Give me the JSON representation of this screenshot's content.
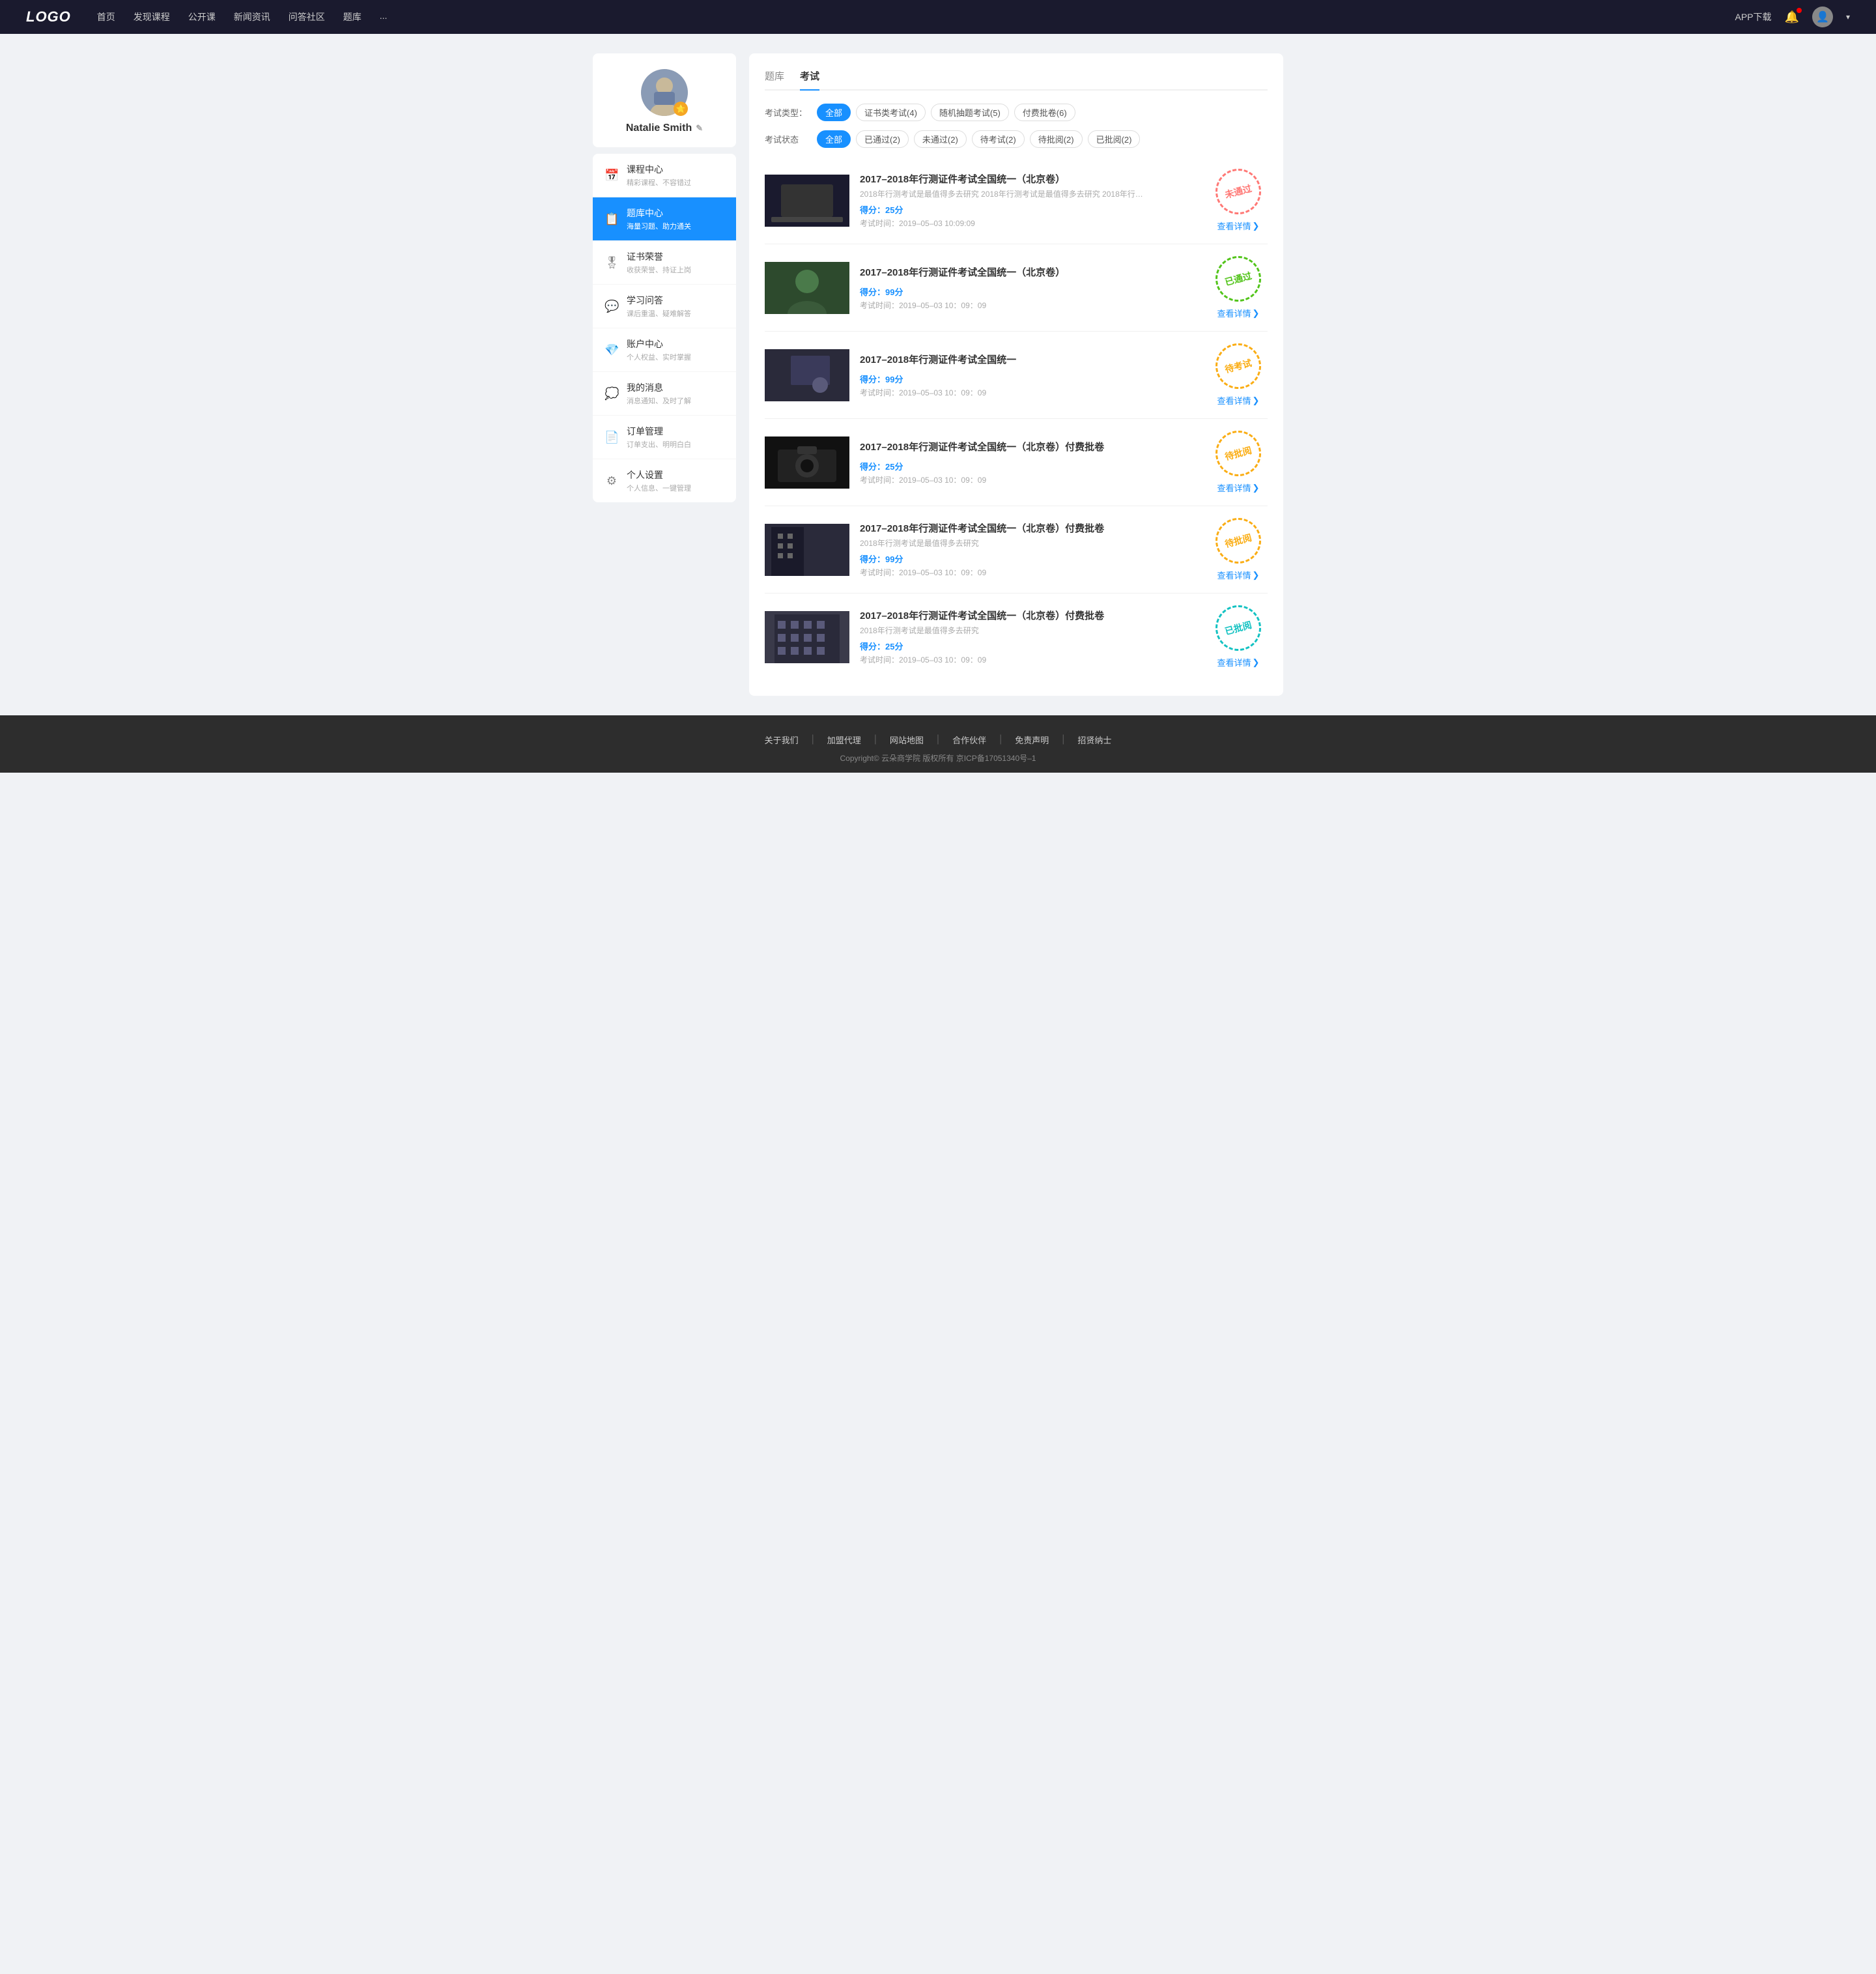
{
  "navbar": {
    "logo": "LOGO",
    "links": [
      "首页",
      "发现课程",
      "公开课",
      "新闻资讯",
      "问答社区",
      "题库",
      "..."
    ],
    "app_download": "APP下载",
    "dropdown_icon": "▾"
  },
  "sidebar": {
    "username": "Natalie Smith",
    "edit_icon": "✎",
    "badge_icon": "★",
    "menu_items": [
      {
        "id": "course-center",
        "icon": "📅",
        "label": "课程中心",
        "sub": "精彩课程、不容错过",
        "active": false
      },
      {
        "id": "question-bank",
        "icon": "📋",
        "label": "题库中心",
        "sub": "海量习题、助力通关",
        "active": true
      },
      {
        "id": "certificate",
        "icon": "🎖",
        "label": "证书荣誉",
        "sub": "收获荣誉、持证上岗",
        "active": false
      },
      {
        "id": "qa",
        "icon": "💬",
        "label": "学习问答",
        "sub": "课后重温、疑难解答",
        "active": false
      },
      {
        "id": "account",
        "icon": "💎",
        "label": "账户中心",
        "sub": "个人权益、实时掌握",
        "active": false
      },
      {
        "id": "messages",
        "icon": "💭",
        "label": "我的消息",
        "sub": "消息通知、及时了解",
        "active": false
      },
      {
        "id": "orders",
        "icon": "📄",
        "label": "订单管理",
        "sub": "订单支出、明明白白",
        "active": false
      },
      {
        "id": "settings",
        "icon": "⚙",
        "label": "个人设置",
        "sub": "个人信息、一键管理",
        "active": false
      }
    ]
  },
  "content": {
    "tabs": [
      {
        "label": "题库",
        "active": false
      },
      {
        "label": "考试",
        "active": true
      }
    ],
    "filter_type": {
      "label": "考试类型：",
      "tags": [
        {
          "label": "全部",
          "active": true
        },
        {
          "label": "证书类考试(4)",
          "active": false
        },
        {
          "label": "随机抽题考试(5)",
          "active": false
        },
        {
          "label": "付费批卷(6)",
          "active": false
        }
      ]
    },
    "filter_status": {
      "label": "考试状态",
      "tags": [
        {
          "label": "全部",
          "active": true
        },
        {
          "label": "已通过(2)",
          "active": false
        },
        {
          "label": "未通过(2)",
          "active": false
        },
        {
          "label": "待考试(2)",
          "active": false
        },
        {
          "label": "待批阅(2)",
          "active": false
        },
        {
          "label": "已批阅(2)",
          "active": false
        }
      ]
    },
    "exams": [
      {
        "id": 1,
        "title": "2017–2018年行测证件考试全国统一（北京卷）",
        "desc": "2018年行测考试是最值得多去研究 2018年行测考试是最值得多去研究 2018年行…",
        "score_label": "得分：",
        "score": "25",
        "score_unit": "分",
        "time_label": "考试时间：",
        "time": "2019–05–03  10:09:09",
        "stamp_text": "未通过",
        "stamp_class": "stamp-failed",
        "detail_text": "查看详情",
        "img_class": "img-laptop"
      },
      {
        "id": 2,
        "title": "2017–2018年行测证件考试全国统一（北京卷）",
        "desc": "",
        "score_label": "得分：",
        "score": "99",
        "score_unit": "分",
        "time_label": "考试时间：",
        "time": "2019–05–03  10：09：09",
        "stamp_text": "已通过",
        "stamp_class": "stamp-passed",
        "detail_text": "查看详情",
        "img_class": "img-girl"
      },
      {
        "id": 3,
        "title": "2017–2018年行测证件考试全国统一",
        "desc": "",
        "score_label": "得分：",
        "score": "99",
        "score_unit": "分",
        "time_label": "考试时间：",
        "time": "2019–05–03  10：09：09",
        "stamp_text": "待考试",
        "stamp_class": "stamp-pending",
        "detail_text": "查看详情",
        "img_class": "img-office"
      },
      {
        "id": 4,
        "title": "2017–2018年行测证件考试全国统一（北京卷）付费批卷",
        "desc": "",
        "score_label": "得分：",
        "score": "25",
        "score_unit": "分",
        "time_label": "考试时间：",
        "time": "2019–05–03  10：09：09",
        "stamp_text": "待批阅",
        "stamp_class": "stamp-review",
        "detail_text": "查看详情",
        "img_class": "img-camera"
      },
      {
        "id": 5,
        "title": "2017–2018年行测证件考试全国统一（北京卷）付费批卷",
        "desc": "2018年行测考试是最值得多去研究",
        "score_label": "得分：",
        "score": "99",
        "score_unit": "分",
        "time_label": "考试时间：",
        "time": "2019–05–03  10：09：09",
        "stamp_text": "待批阅",
        "stamp_class": "stamp-review",
        "detail_text": "查看详情",
        "img_class": "img-building1"
      },
      {
        "id": 6,
        "title": "2017–2018年行测证件考试全国统一（北京卷）付费批卷",
        "desc": "2018年行测考试是最值得多去研究",
        "score_label": "得分：",
        "score": "25",
        "score_unit": "分",
        "time_label": "考试时间：",
        "time": "2019–05–03  10：09：09",
        "stamp_text": "已批阅",
        "stamp_class": "stamp-reviewed",
        "detail_text": "查看详情",
        "img_class": "img-building2"
      }
    ]
  },
  "footer": {
    "links": [
      "关于我们",
      "加盟代理",
      "网站地图",
      "合作伙伴",
      "免责声明",
      "招贤纳士"
    ],
    "copyright": "Copyright© 云朵商学院  版权所有    京ICP备17051340号–1"
  }
}
